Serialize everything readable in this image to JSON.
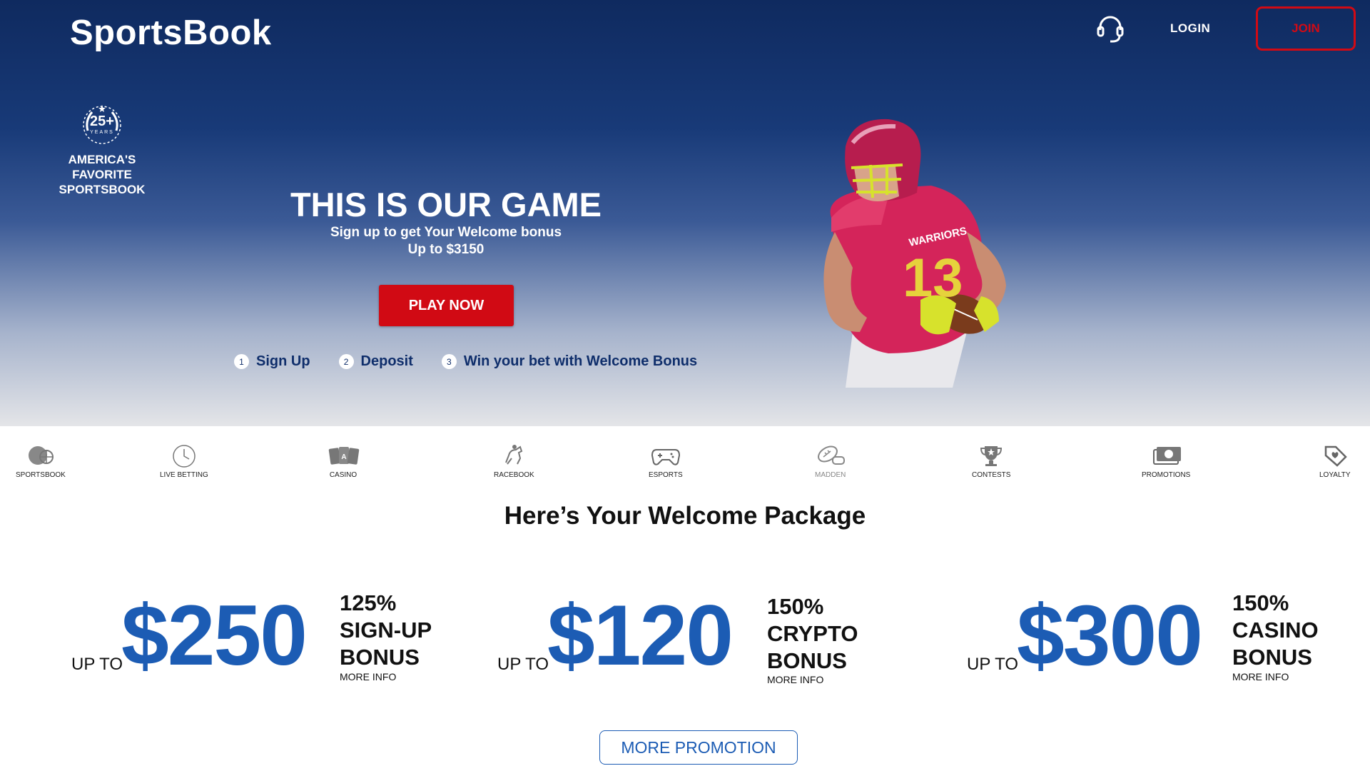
{
  "header": {
    "logo": "SportsBook",
    "support_icon": "headset-icon",
    "login_label": "LOGIN",
    "join_label": "JOIN"
  },
  "badge": {
    "emblem": "25+",
    "emblem_sub": "YEARS",
    "text": "AMERICA'S FAVORITE SPORTSBOOK"
  },
  "hero": {
    "title": "THIS IS OUR GAME",
    "subtitle": "Sign up to get Your Welcome bonus",
    "subtitle2": "Up to $3150",
    "cta_label": "PLAY NOW",
    "steps": [
      {
        "num": "1",
        "label": "Sign Up"
      },
      {
        "num": "2",
        "label": "Deposit"
      },
      {
        "num": "3",
        "label": "Win your bet with Welcome Bonus"
      }
    ],
    "player_jersey": {
      "team": "WARRIORS",
      "number": "13"
    }
  },
  "nav": {
    "items": [
      {
        "label": "SPORTSBOOK",
        "icon": "sports-balls-icon"
      },
      {
        "label": "LIVE BETTING",
        "icon": "clock-icon"
      },
      {
        "label": "CASINO",
        "icon": "cards-icon"
      },
      {
        "label": "RACEBOOK",
        "icon": "horse-racing-icon"
      },
      {
        "label": "ESPORTS",
        "icon": "gamepad-icon"
      },
      {
        "label": "MADDEN",
        "icon": "football-controller-icon"
      },
      {
        "label": "CONTESTS",
        "icon": "trophy-icon"
      },
      {
        "label": "PROMOTIONS",
        "icon": "money-icon"
      },
      {
        "label": "LOYALTY",
        "icon": "tag-heart-icon"
      }
    ]
  },
  "welcome_heading": "Here’s Your Welcome Package",
  "bonuses": [
    {
      "upto": "UP TO",
      "amount": "$250",
      "line1": "125%",
      "line2": "SIGN-UP",
      "line3": "BONUS",
      "more": "MORE INFO"
    },
    {
      "upto": "UP TO",
      "amount": "$120",
      "line1": "150%",
      "line2": "CRYPTO",
      "line3": "BONUS",
      "more": "MORE INFO"
    },
    {
      "upto": "UP TO",
      "amount": "$300",
      "line1": "150%",
      "line2": "CASINO",
      "line3": "BONUS",
      "more": "MORE INFO"
    }
  ],
  "more_promotion_label": "MORE PROMOTION",
  "colors": {
    "brand_navy": "#0f2a5f",
    "accent_red": "#d10a14",
    "bonus_blue": "#1c5cb4"
  }
}
